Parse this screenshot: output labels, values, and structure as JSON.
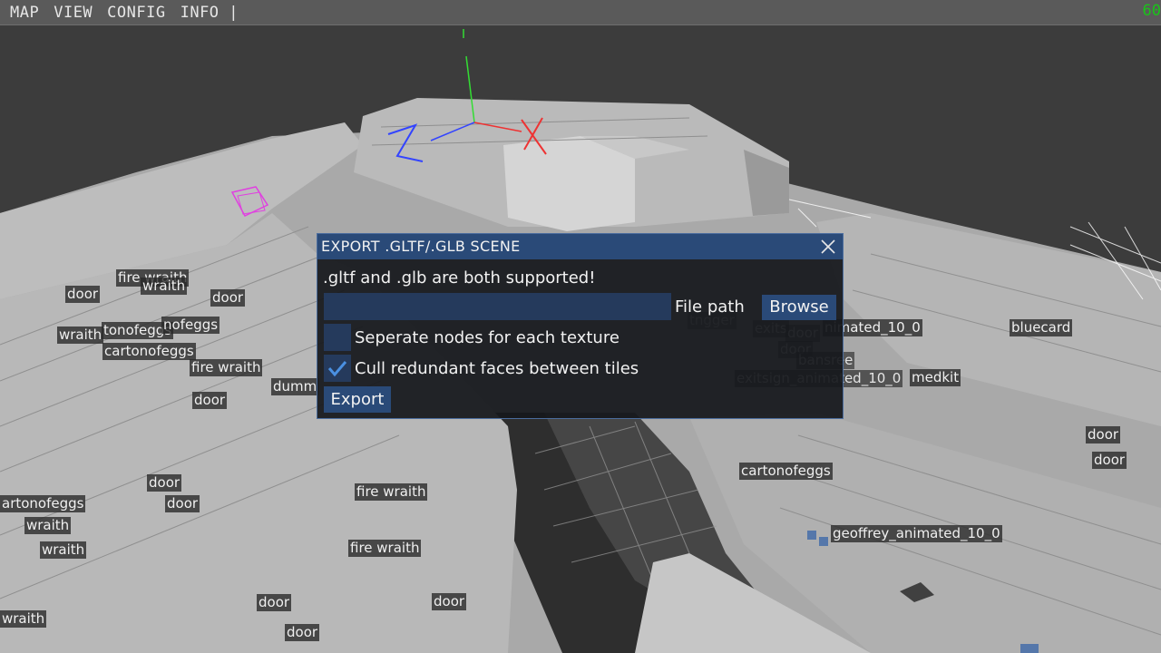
{
  "menubar": {
    "items": [
      "MAP",
      "VIEW",
      "CONFIG",
      "INFO |"
    ],
    "fps": "60"
  },
  "scene_labels": [
    "fire wraith",
    "wraith",
    "door",
    "door",
    "wraith",
    "tonofeggs",
    "nofeggs",
    "cartonofeggs",
    "fire wraith",
    "dumm",
    "door",
    "door",
    "door",
    "artonofeggs",
    "wraith",
    "wraith",
    "fire wraith",
    "fire wraith",
    "door",
    "door",
    "door",
    "wraith",
    "tngger",
    "exits",
    "door",
    "door",
    "nimated_10_0",
    "bansree",
    "exitsign_animated_10_0",
    "medkit",
    "bluecard",
    "cartonofeggs",
    "geoffrey_animated_10_0",
    "door",
    "door"
  ],
  "dialog": {
    "title": "EXPORT .GLTF/.GLB SCENE",
    "description": ".gltf and .glb are both supported!",
    "file_path_value": "",
    "file_path_label": "File path",
    "browse_label": "Browse",
    "options": [
      {
        "label": "Seperate nodes for each texture",
        "checked": false
      },
      {
        "label": "Cull redundant faces between tiles",
        "checked": true
      }
    ],
    "export_label": "Export"
  },
  "colors": {
    "accent": "#2a4a78",
    "input_bg": "#253a5c",
    "check": "#4a90e2",
    "fps": "#19c419"
  }
}
